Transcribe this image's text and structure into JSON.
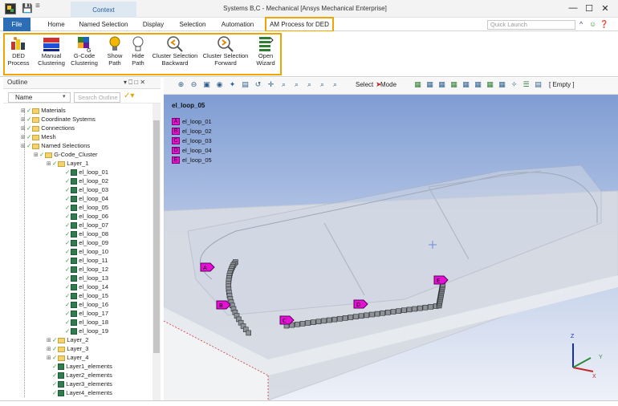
{
  "titlebar": {
    "context_tab": "Context",
    "title": "Systems B,C - Mechanical [Ansys Mechanical Enterprise]",
    "minimize": "—",
    "maximize": "☐",
    "close": "✕"
  },
  "tabs": {
    "file": "File",
    "home": "Home",
    "named_selection": "Named Selection",
    "display": "Display",
    "selection": "Selection",
    "automation": "Automation",
    "am_process": "AM Process for DED"
  },
  "quick_launch": {
    "placeholder": "Quick Launch"
  },
  "ribbon": {
    "ded_process": "DED\nProcess",
    "manual_clustering": "Manual\nClustering",
    "gcode_clustering": "G-Code\nClustering",
    "show_path": "Show\nPath",
    "hide_path": "Hide\nPath",
    "cluster_backward": "Cluster Selection\nBackward",
    "cluster_forward": "Cluster Selection\nForward",
    "open_wizard": "Open\nWizard"
  },
  "outline": {
    "title": "Outline",
    "name_select": "Name",
    "search_placeholder": "Search Outline",
    "nodes": [
      {
        "label": "Materials"
      },
      {
        "label": "Coordinate Systems"
      },
      {
        "label": "Connections"
      },
      {
        "label": "Mesh"
      },
      {
        "label": "Named Selections"
      },
      {
        "label": "G-Code_Cluster"
      },
      {
        "label": "Layer_1"
      },
      {
        "label": "el_loop_01"
      },
      {
        "label": "el_loop_02"
      },
      {
        "label": "el_loop_03"
      },
      {
        "label": "el_loop_04"
      },
      {
        "label": "el_loop_05"
      },
      {
        "label": "el_loop_06"
      },
      {
        "label": "el_loop_07"
      },
      {
        "label": "el_loop_08"
      },
      {
        "label": "el_loop_09"
      },
      {
        "label": "el_loop_10"
      },
      {
        "label": "el_loop_11"
      },
      {
        "label": "el_loop_12"
      },
      {
        "label": "el_loop_13"
      },
      {
        "label": "el_loop_14"
      },
      {
        "label": "el_loop_15"
      },
      {
        "label": "el_loop_16"
      },
      {
        "label": "el_loop_17"
      },
      {
        "label": "el_loop_18"
      },
      {
        "label": "el_loop_19"
      },
      {
        "label": "Layer_2"
      },
      {
        "label": "Layer_3"
      },
      {
        "label": "Layer_4"
      },
      {
        "label": "Layer1_elements"
      },
      {
        "label": "Layer2_elements"
      },
      {
        "label": "Layer3_elements"
      },
      {
        "label": "Layer4_elements"
      }
    ]
  },
  "viewport_toolbar": {
    "select": "Select",
    "mode": "Mode",
    "empty": "[ Empty ]"
  },
  "viewport": {
    "title": "el_loop_05",
    "legend": [
      {
        "letter": "A",
        "label": "el_loop_01"
      },
      {
        "letter": "B",
        "label": "el_loop_02"
      },
      {
        "letter": "C",
        "label": "el_loop_03"
      },
      {
        "letter": "D",
        "label": "el_loop_04"
      },
      {
        "letter": "E",
        "label": "el_loop_05"
      }
    ],
    "axis": {
      "z": "Z",
      "y": "Y",
      "x": "X"
    },
    "colors": {
      "marker": "#e60fd6",
      "accent": "#f0a400",
      "file_tab": "#2c6eb5"
    }
  }
}
